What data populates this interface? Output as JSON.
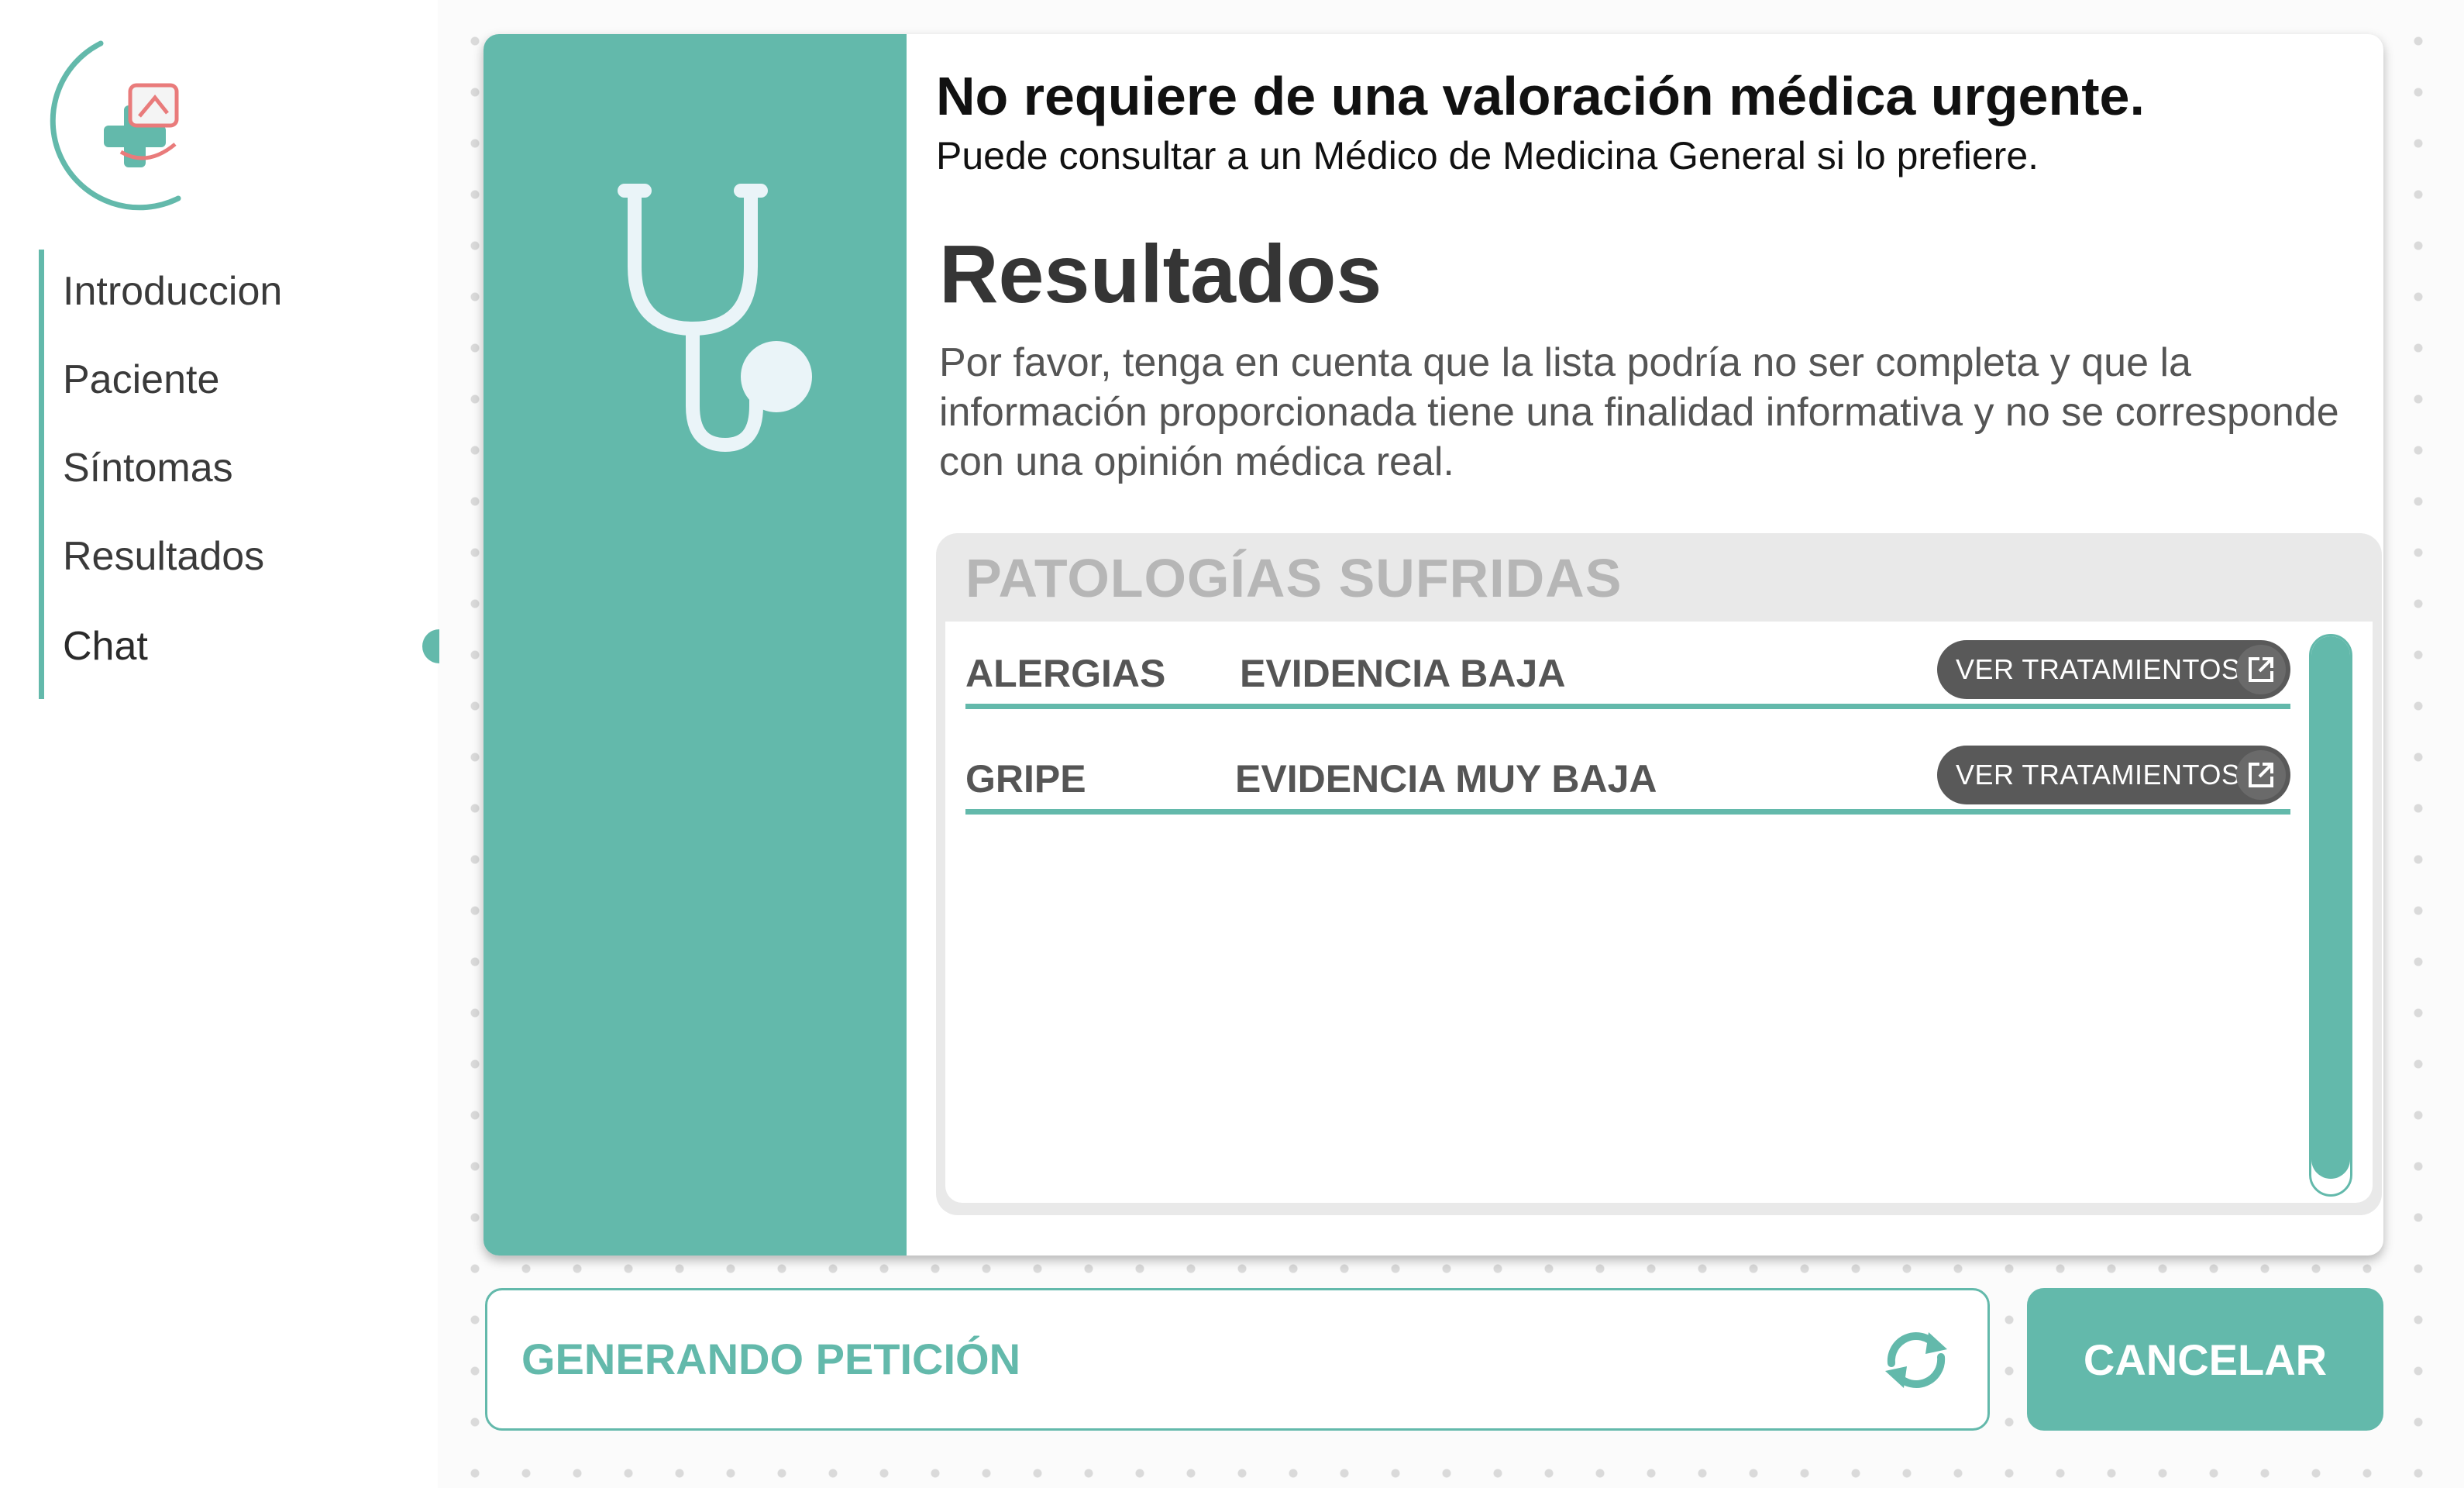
{
  "sidebar": {
    "logo_icon": "medical-cross-logo",
    "items": [
      {
        "label": "Introduccion"
      },
      {
        "label": "Paciente"
      },
      {
        "label": "Síntomas"
      },
      {
        "label": "Resultados"
      },
      {
        "label": "Chat"
      }
    ],
    "active_item": "Chat"
  },
  "card": {
    "illustration_icon": "stethoscope-icon",
    "urgency_title": "No requiere de una valoración médica urgente.",
    "urgency_subtitle": "Puede consultar a un Médico de Medicina General si lo prefiere.",
    "results_title": "Resultados",
    "disclaimer": "Por favor, tenga en cuenta que la lista podría no ser completa y que la información proporcionada tiene una finalidad informativa y no se corresponde con una opinión médica real.",
    "panel": {
      "header": "PATOLOGÍAS SUFRIDAS",
      "rows": [
        {
          "name": "ALERGIAS",
          "evidence": "EVIDENCIA BAJA",
          "button_label": "VER TRATAMIENTOS"
        },
        {
          "name": "GRIPE",
          "evidence": "EVIDENCIA MUY BAJA",
          "button_label": "VER TRATAMIENTOS"
        }
      ]
    }
  },
  "footer": {
    "status_text": "GENERANDO PETICIÓN",
    "refresh_icon": "refresh-icon",
    "cancel_label": "CANCELAR"
  },
  "colors": {
    "accent": "#63b9ab",
    "button_dark": "#595959",
    "header_gray": "#b6b6b6"
  }
}
